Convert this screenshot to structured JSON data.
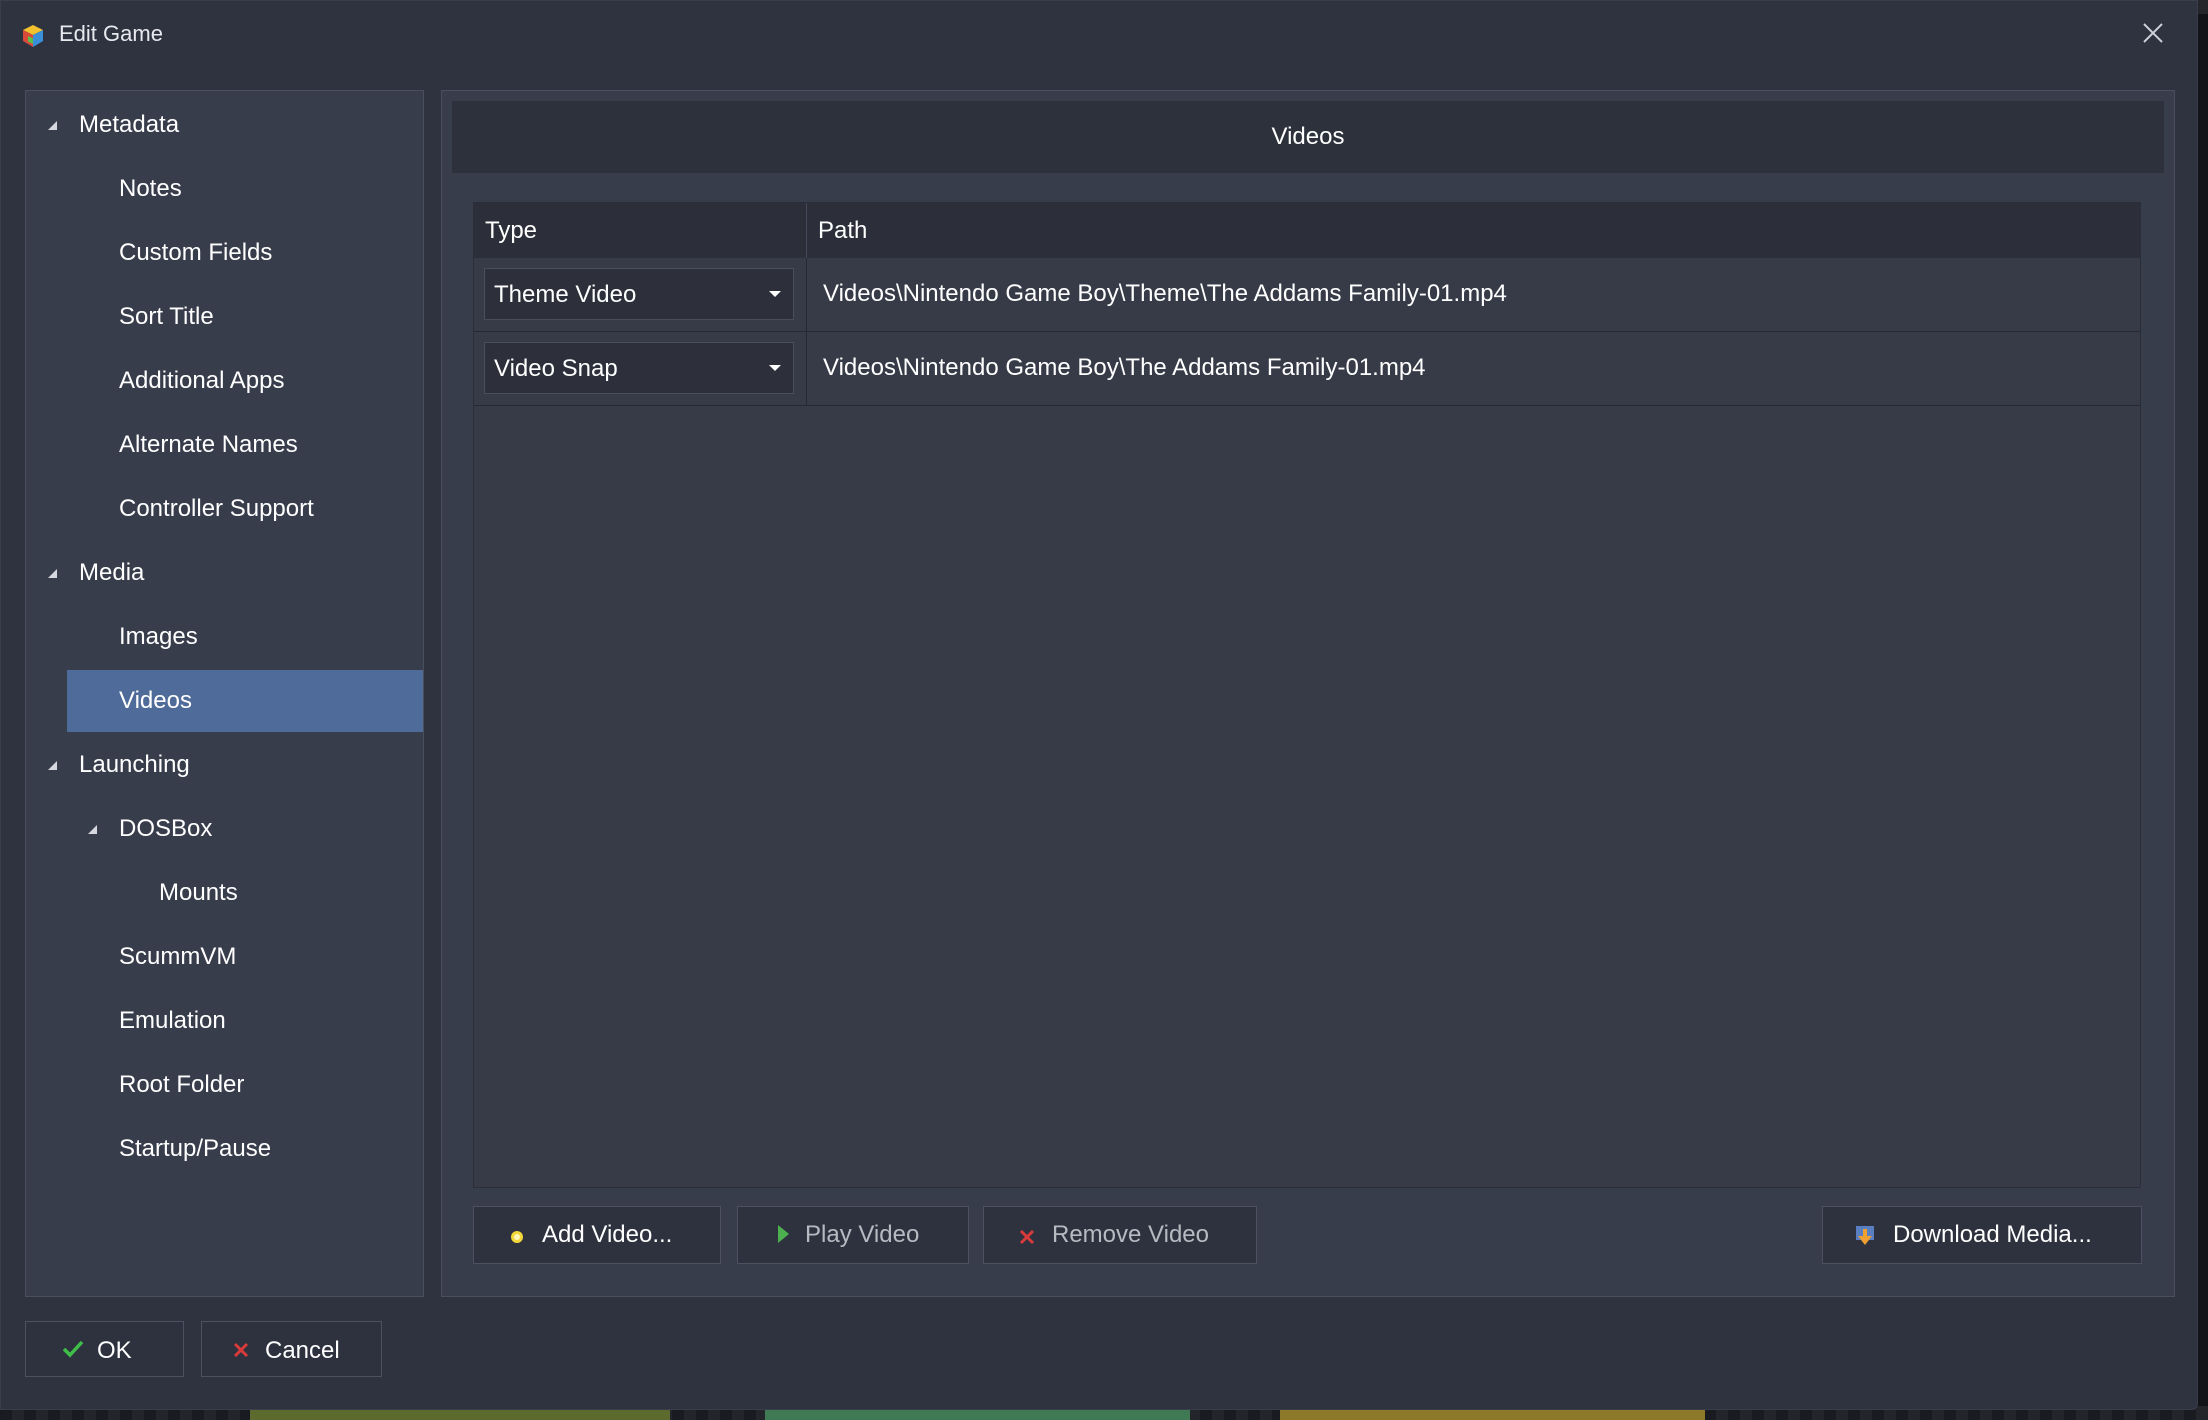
{
  "window": {
    "title": "Edit Game",
    "close_icon": "close-icon"
  },
  "sidebar": {
    "items": [
      {
        "label": "Metadata",
        "expanded": true
      },
      {
        "label": "Notes"
      },
      {
        "label": "Custom Fields"
      },
      {
        "label": "Sort Title"
      },
      {
        "label": "Additional Apps"
      },
      {
        "label": "Alternate Names"
      },
      {
        "label": "Controller Support"
      },
      {
        "label": "Media",
        "expanded": true
      },
      {
        "label": "Images"
      },
      {
        "label": "Videos",
        "selected": true
      },
      {
        "label": "Launching",
        "expanded": true
      },
      {
        "label": "DOSBox",
        "expanded": true
      },
      {
        "label": "Mounts"
      },
      {
        "label": "ScummVM"
      },
      {
        "label": "Emulation"
      },
      {
        "label": "Root Folder"
      },
      {
        "label": "Startup/Pause"
      }
    ],
    "selected_color": "#4f6b9a"
  },
  "main": {
    "section_title": "Videos",
    "columns": [
      "Type",
      "Path"
    ],
    "rows": [
      {
        "type": "Theme Video",
        "path": "Videos\\Nintendo Game Boy\\Theme\\The Addams Family-01.mp4"
      },
      {
        "type": "Video Snap",
        "path": "Videos\\Nintendo Game Boy\\The Addams Family-01.mp4"
      }
    ],
    "buttons": {
      "add": "Add Video...",
      "play": "Play Video",
      "remove": "Remove Video",
      "download": "Download Media..."
    }
  },
  "footer": {
    "ok": "OK",
    "cancel": "Cancel"
  },
  "colors": {
    "dialog_bg": "#2f3340",
    "panel_bg": "#383d4c",
    "header_bg": "#2d313c"
  }
}
